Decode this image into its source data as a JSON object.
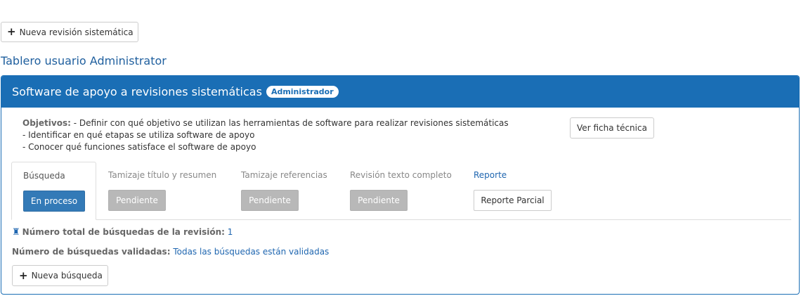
{
  "toolbar": {
    "new_review_label": "Nueva revisión sistemática",
    "plus_icon": "plus-icon"
  },
  "dashboard": {
    "title": "Tablero usuario Administrator"
  },
  "panel": {
    "title": "Software de apoyo a revisiones sistemáticas",
    "role_badge": "Administrador",
    "header_color": "#1a6eb5",
    "objectives_label": "Objetivos:",
    "objectives": [
      "- Definir con qué objetivo se utilizan las herramientas de software para realizar revisiones sistemáticas",
      "- Identificar en qué etapas se utiliza software de apoyo",
      "- Conocer qué funciones satisface el software de apoyo"
    ],
    "tech_sheet_label": "Ver ficha técnica"
  },
  "stages": [
    {
      "name": "Búsqueda",
      "status": "En proceso"
    },
    {
      "name": "Tamizaje título y resumen",
      "status": "Pendiente"
    },
    {
      "name": "Tamizaje referencias",
      "status": "Pendiente"
    },
    {
      "name": "Revisión texto completo",
      "status": "Pendiente"
    },
    {
      "name": "Reporte",
      "status": "Reporte Parcial"
    }
  ],
  "search_info": {
    "total_label": "Número total de búsquedas de la revisión:",
    "total_value": "1",
    "validated_label": "Número de búsquedas validadas:",
    "validated_value": "Todas las búsquedas están validadas",
    "new_search_label": "Nueva búsqueda",
    "total_icon": "rook-icon"
  }
}
